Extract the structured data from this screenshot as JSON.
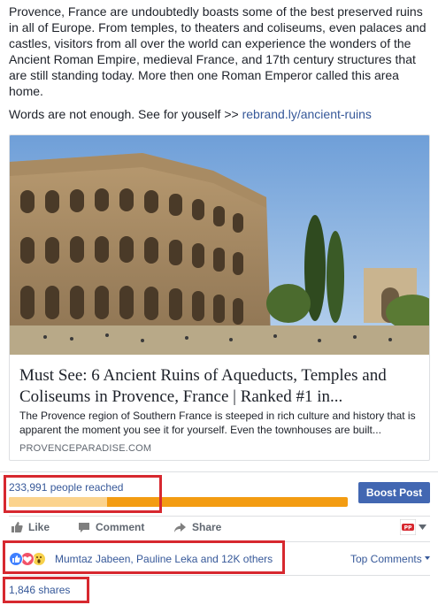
{
  "post": {
    "paragraph1": "Provence, France are undoubtedly boasts some of the best preserved ruins in all of Europe. From temples, to theaters and coliseums, even palaces and castles, visitors from all over the world can experience the wonders of the Ancient Roman Empire, medieval France, and 17th century structures that are still standing today. More then one Roman Emperor called this area home.",
    "paragraph2_prefix": "Words are not enough. See for youself >> ",
    "link": "rebrand.ly/ancient-ruins"
  },
  "card": {
    "image_subject": "Colosseum ruins photo",
    "title": "Must See: 6 Ancient Ruins of Aqueducts, Temples and Coliseums in Provence, France | Ranked #1 in...",
    "description": "The Provence region of Southern France is steeped in rich culture and history that is apparent the moment you see it for yourself. Even the townhouses are built...",
    "domain": "PROVENCEPARADISE.COM"
  },
  "insights": {
    "reach_text": "233,991 people reached",
    "organic_fraction": 0.29,
    "boost_label": "Boost Post"
  },
  "actions": {
    "like": "Like",
    "comment": "Comment",
    "share": "Share",
    "like_icon": "thumbs-up-icon",
    "comment_icon": "speech-bubble-icon",
    "share_icon": "share-arrow-icon",
    "page_icon": "page-avatar-icon",
    "dropdown_icon": "caret-down-icon"
  },
  "reactions": {
    "icons": [
      "like-reaction-icon",
      "love-reaction-icon",
      "wow-reaction-icon"
    ],
    "names": "Mumtaz Jabeen, Pauline Leka and 12K others",
    "top_comments": "Top Comments"
  },
  "shares": {
    "text": "1,846 shares"
  },
  "colors": {
    "link": "#365899",
    "boost": "#4267b2",
    "bar_paid": "#f39c12",
    "bar_organic": "#fbd38d",
    "highlight": "#d7282f"
  }
}
